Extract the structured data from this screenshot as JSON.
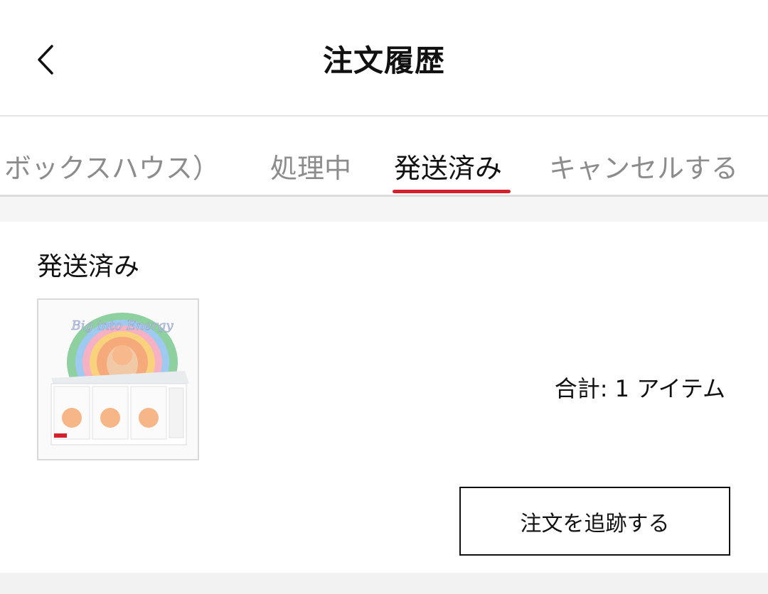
{
  "header": {
    "title": "注文履歴",
    "back_icon": "chevron-left-icon"
  },
  "tabs": [
    {
      "label": "ボックスハウス）",
      "active": false
    },
    {
      "label": "処理中",
      "active": false
    },
    {
      "label": "発送済み",
      "active": true
    },
    {
      "label": "キャンセルする",
      "active": false
    }
  ],
  "colors": {
    "accent": "#d3202c",
    "inactive_tab": "#8c8c8c"
  },
  "order": {
    "status": "発送済み",
    "total_text": "合計: 1 アイテム",
    "track_button": "注文を追跡する",
    "product_image": {
      "packaging_text": "Big into Energy"
    }
  }
}
